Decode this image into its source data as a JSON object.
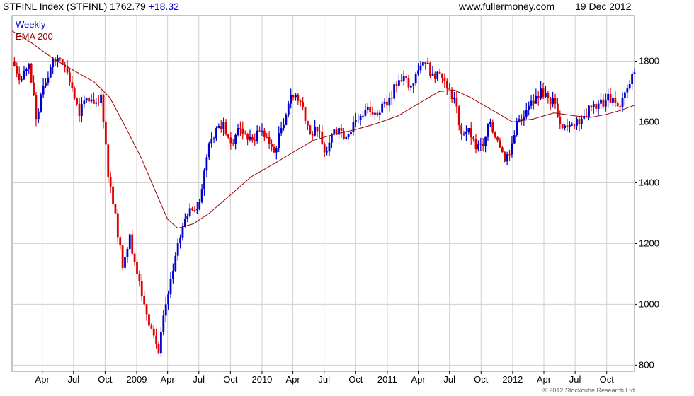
{
  "header": {
    "index_label": "STFINL Index (STFINL) 1762.79",
    "change": "+18.32",
    "site": "www.fullermoney.com",
    "date": "19 Dec 2012"
  },
  "legend": {
    "period": "Weekly",
    "ema": "EMA 200"
  },
  "copyright": "© 2012 Stockcube Research Ltd",
  "colors": {
    "up": "#0000cc",
    "down": "#dd0000",
    "ema": "#990000",
    "grid": "#d0d0d0",
    "header_blue": "#0000cc"
  },
  "chart_data": {
    "type": "line",
    "title": "STFINL Index (STFINL) 1762.79 +18.32",
    "xlabel": "",
    "ylabel": "",
    "ylim": [
      780,
      1950
    ],
    "yticks": [
      800,
      1000,
      1200,
      1400,
      1600,
      1800
    ],
    "xlim": [
      "2008-01-04",
      "2012-12-21"
    ],
    "xticks": [
      {
        "label": "Apr",
        "date": "2008-04-01"
      },
      {
        "label": "Jul",
        "date": "2008-07-01"
      },
      {
        "label": "Oct",
        "date": "2008-10-01"
      },
      {
        "label": "2009",
        "date": "2009-01-01"
      },
      {
        "label": "Apr",
        "date": "2009-04-01"
      },
      {
        "label": "Jul",
        "date": "2009-07-01"
      },
      {
        "label": "Oct",
        "date": "2009-10-01"
      },
      {
        "label": "2010",
        "date": "2010-01-01"
      },
      {
        "label": "Apr",
        "date": "2010-04-01"
      },
      {
        "label": "Jul",
        "date": "2010-07-01"
      },
      {
        "label": "Oct",
        "date": "2010-10-01"
      },
      {
        "label": "2011",
        "date": "2011-01-01"
      },
      {
        "label": "Apr",
        "date": "2011-04-01"
      },
      {
        "label": "Jul",
        "date": "2011-07-01"
      },
      {
        "label": "Oct",
        "date": "2011-10-01"
      },
      {
        "label": "2012",
        "date": "2012-01-01"
      },
      {
        "label": "Apr",
        "date": "2012-04-01"
      },
      {
        "label": "Jul",
        "date": "2012-07-01"
      },
      {
        "label": "Oct",
        "date": "2012-10-01"
      }
    ],
    "grid": true,
    "series": [
      {
        "name": "Weekly",
        "kind": "price",
        "points": [
          [
            "2008-01-04",
            1800
          ],
          [
            "2008-02-01",
            1740
          ],
          [
            "2008-02-22",
            1790
          ],
          [
            "2008-03-14",
            1610
          ],
          [
            "2008-04-04",
            1720
          ],
          [
            "2008-04-25",
            1780
          ],
          [
            "2008-05-16",
            1810
          ],
          [
            "2008-06-06",
            1780
          ],
          [
            "2008-06-27",
            1710
          ],
          [
            "2008-07-18",
            1620
          ],
          [
            "2008-08-08",
            1680
          ],
          [
            "2008-08-29",
            1660
          ],
          [
            "2008-09-19",
            1690
          ],
          [
            "2008-10-10",
            1420
          ],
          [
            "2008-10-31",
            1300
          ],
          [
            "2008-11-21",
            1120
          ],
          [
            "2008-12-12",
            1230
          ],
          [
            "2009-01-02",
            1100
          ],
          [
            "2009-01-23",
            1000
          ],
          [
            "2009-02-13",
            920
          ],
          [
            "2009-03-06",
            840
          ],
          [
            "2009-03-27",
            1000
          ],
          [
            "2009-04-17",
            1110
          ],
          [
            "2009-05-08",
            1220
          ],
          [
            "2009-05-29",
            1290
          ],
          [
            "2009-06-19",
            1310
          ],
          [
            "2009-07-10",
            1380
          ],
          [
            "2009-07-31",
            1530
          ],
          [
            "2009-08-21",
            1580
          ],
          [
            "2009-09-11",
            1600
          ],
          [
            "2009-10-02",
            1530
          ],
          [
            "2009-10-23",
            1580
          ],
          [
            "2009-11-13",
            1560
          ],
          [
            "2009-12-04",
            1540
          ],
          [
            "2009-12-25",
            1570
          ],
          [
            "2010-01-15",
            1550
          ],
          [
            "2010-02-05",
            1500
          ],
          [
            "2010-02-26",
            1580
          ],
          [
            "2010-03-19",
            1660
          ],
          [
            "2010-04-09",
            1690
          ],
          [
            "2010-04-30",
            1650
          ],
          [
            "2010-05-21",
            1560
          ],
          [
            "2010-06-11",
            1570
          ],
          [
            "2010-07-02",
            1500
          ],
          [
            "2010-07-23",
            1560
          ],
          [
            "2010-08-13",
            1580
          ],
          [
            "2010-09-03",
            1550
          ],
          [
            "2010-09-24",
            1600
          ],
          [
            "2010-10-15",
            1620
          ],
          [
            "2010-11-05",
            1650
          ],
          [
            "2010-11-26",
            1630
          ],
          [
            "2010-12-17",
            1660
          ],
          [
            "2011-01-07",
            1680
          ],
          [
            "2011-01-28",
            1720
          ],
          [
            "2011-02-18",
            1750
          ],
          [
            "2011-03-11",
            1720
          ],
          [
            "2011-04-01",
            1770
          ],
          [
            "2011-04-22",
            1790
          ],
          [
            "2011-05-13",
            1760
          ],
          [
            "2011-06-03",
            1760
          ],
          [
            "2011-06-24",
            1710
          ],
          [
            "2011-07-15",
            1680
          ],
          [
            "2011-08-05",
            1560
          ],
          [
            "2011-08-26",
            1580
          ],
          [
            "2011-09-16",
            1510
          ],
          [
            "2011-10-07",
            1520
          ],
          [
            "2011-10-28",
            1600
          ],
          [
            "2011-11-18",
            1540
          ],
          [
            "2011-12-09",
            1470
          ],
          [
            "2011-12-30",
            1530
          ],
          [
            "2012-01-20",
            1610
          ],
          [
            "2012-02-10",
            1640
          ],
          [
            "2012-03-02",
            1660
          ],
          [
            "2012-03-23",
            1710
          ],
          [
            "2012-04-13",
            1680
          ],
          [
            "2012-05-04",
            1660
          ],
          [
            "2012-05-25",
            1580
          ],
          [
            "2012-06-15",
            1590
          ],
          [
            "2012-07-06",
            1610
          ],
          [
            "2012-07-27",
            1620
          ],
          [
            "2012-08-17",
            1650
          ],
          [
            "2012-09-07",
            1660
          ],
          [
            "2012-09-28",
            1670
          ],
          [
            "2012-10-19",
            1680
          ],
          [
            "2012-11-09",
            1650
          ],
          [
            "2012-11-30",
            1710
          ],
          [
            "2012-12-21",
            1763
          ]
        ]
      },
      {
        "name": "EMA 200",
        "kind": "ema",
        "points": [
          [
            "2008-01-04",
            1900
          ],
          [
            "2008-03-01",
            1860
          ],
          [
            "2008-05-01",
            1810
          ],
          [
            "2008-07-01",
            1770
          ],
          [
            "2008-09-01",
            1730
          ],
          [
            "2008-10-15",
            1680
          ],
          [
            "2008-12-01",
            1580
          ],
          [
            "2009-01-15",
            1480
          ],
          [
            "2009-03-01",
            1360
          ],
          [
            "2009-04-01",
            1280
          ],
          [
            "2009-05-01",
            1250
          ],
          [
            "2009-06-15",
            1265
          ],
          [
            "2009-08-01",
            1300
          ],
          [
            "2009-10-01",
            1360
          ],
          [
            "2009-12-01",
            1420
          ],
          [
            "2010-02-01",
            1460
          ],
          [
            "2010-04-01",
            1500
          ],
          [
            "2010-06-01",
            1540
          ],
          [
            "2010-08-01",
            1560
          ],
          [
            "2010-10-01",
            1575
          ],
          [
            "2010-12-01",
            1595
          ],
          [
            "2011-02-01",
            1620
          ],
          [
            "2011-04-01",
            1660
          ],
          [
            "2011-06-01",
            1700
          ],
          [
            "2011-07-15",
            1705
          ],
          [
            "2011-09-01",
            1680
          ],
          [
            "2011-11-01",
            1640
          ],
          [
            "2012-01-01",
            1600
          ],
          [
            "2012-03-01",
            1610
          ],
          [
            "2012-05-01",
            1630
          ],
          [
            "2012-07-01",
            1620
          ],
          [
            "2012-08-15",
            1615
          ],
          [
            "2012-10-01",
            1625
          ],
          [
            "2012-11-15",
            1640
          ],
          [
            "2012-12-21",
            1655
          ]
        ]
      }
    ]
  }
}
